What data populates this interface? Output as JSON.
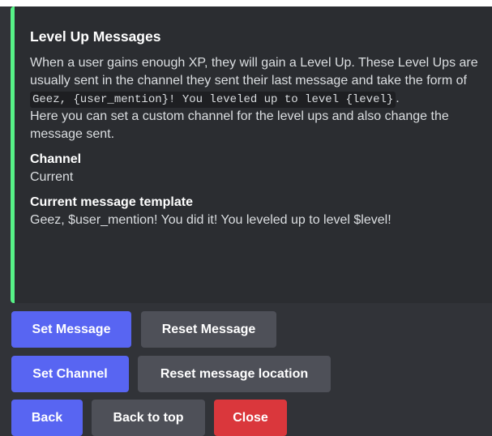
{
  "embed": {
    "accent_color": "#57f287",
    "title": "Level Up Messages",
    "desc_intro": "When a user gains enough XP, they will gain a Level Up. These Level Ups are usually sent in the channel they sent their last message and take the form of ",
    "desc_code": "Geez, {user_mention}! You leveled up to level {level}",
    "desc_period": ".",
    "desc_custom": "Here you can set a custom channel for the level ups and also change the message sent.",
    "fields": [
      {
        "name": "Channel",
        "value": "Current"
      },
      {
        "name": "Current message template",
        "value": "Geez, $user_mention! You did it! You leveled up to level $level!"
      }
    ]
  },
  "buttons": {
    "row1": {
      "set_message": "Set Message",
      "reset_message": "Reset Message"
    },
    "row2": {
      "set_channel": "Set Channel",
      "reset_location": "Reset message location"
    },
    "row3": {
      "back": "Back",
      "back_to_top": "Back to top",
      "close": "Close"
    }
  },
  "colors": {
    "primary": "#5865f2",
    "secondary": "#4e5058",
    "danger": "#da373c",
    "background": "#313338",
    "embed_background": "#2b2d31"
  }
}
